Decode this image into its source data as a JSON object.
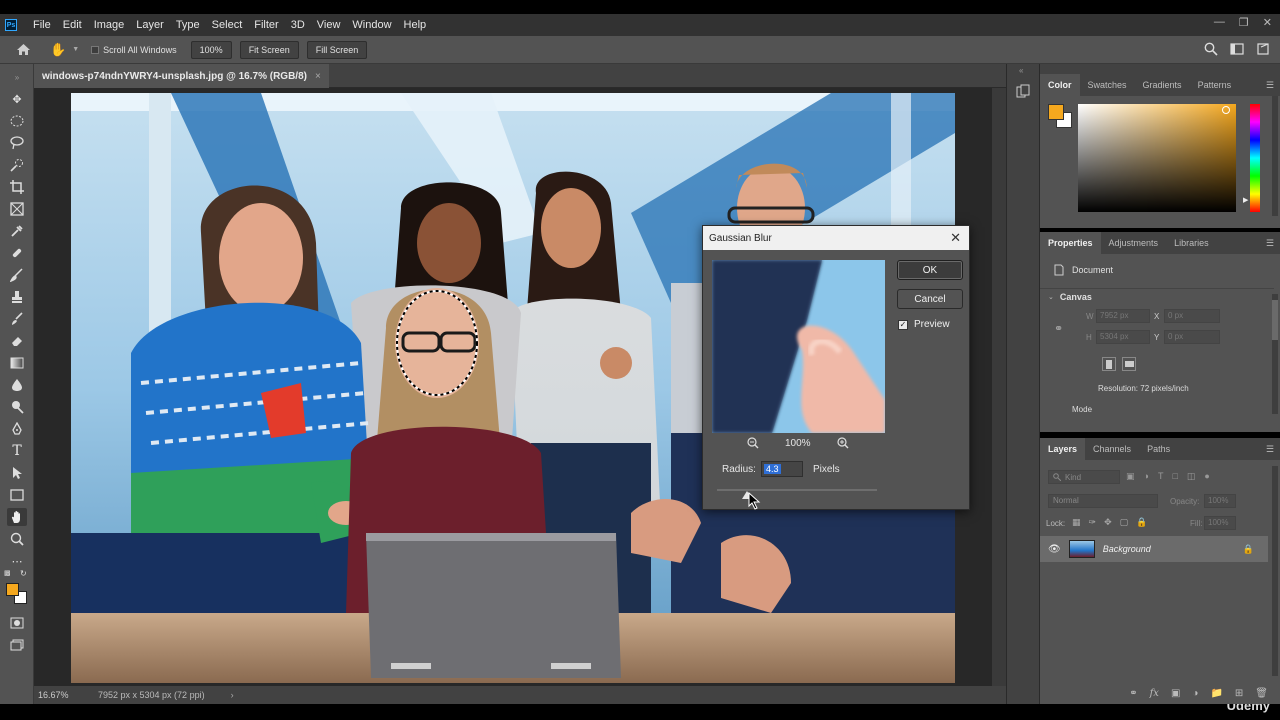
{
  "app": {
    "logo": "Ps"
  },
  "menu": [
    "File",
    "Edit",
    "Image",
    "Layer",
    "Type",
    "Select",
    "Filter",
    "3D",
    "View",
    "Window",
    "Help"
  ],
  "options_bar": {
    "scroll_all_windows": "Scroll All Windows",
    "zoom_value": "100%",
    "fit_screen": "Fit Screen",
    "fill_screen": "Fill Screen"
  },
  "document": {
    "tab_title": "windows-p74ndnYWRY4-unsplash.jpg @ 16.7% (RGB/8)",
    "zoom": "16.67%",
    "size_info": "7952 px x 5304 px (72 ppi)"
  },
  "color_panel": {
    "tabs": [
      "Color",
      "Swatches",
      "Gradients",
      "Patterns"
    ],
    "active_tab": "Color",
    "foreground_color": "#f5a81e",
    "background_color": "#ffffff",
    "hue_color": "#f5a81e"
  },
  "properties_panel": {
    "tabs": [
      "Properties",
      "Adjustments",
      "Libraries"
    ],
    "document_label": "Document",
    "canvas_label": "Canvas",
    "w_label": "W",
    "w_value": "7952 px",
    "h_label": "H",
    "h_value": "5304 px",
    "x_label": "X",
    "x_value": "0 px",
    "y_label": "Y",
    "y_value": "0 px",
    "resolution": "Resolution: 72 pixels/inch",
    "mode_label": "Mode"
  },
  "layers_panel": {
    "tabs": [
      "Layers",
      "Channels",
      "Paths"
    ],
    "kind_label": "Kind",
    "blend_mode": "Normal",
    "opacity_label": "Opacity:",
    "opacity_value": "100%",
    "lock_label": "Lock:",
    "fill_label": "Fill:",
    "fill_value": "100%",
    "layer_name": "Background"
  },
  "gaussian_blur": {
    "title": "Gaussian Blur",
    "ok": "OK",
    "cancel": "Cancel",
    "preview_label": "Preview",
    "preview_checked": true,
    "preview_zoom": "100%",
    "radius_label": "Radius:",
    "radius_value": "4.3",
    "radius_unit": "Pixels",
    "radius_slider_fraction": 0.19
  },
  "watermark": "Udemy"
}
